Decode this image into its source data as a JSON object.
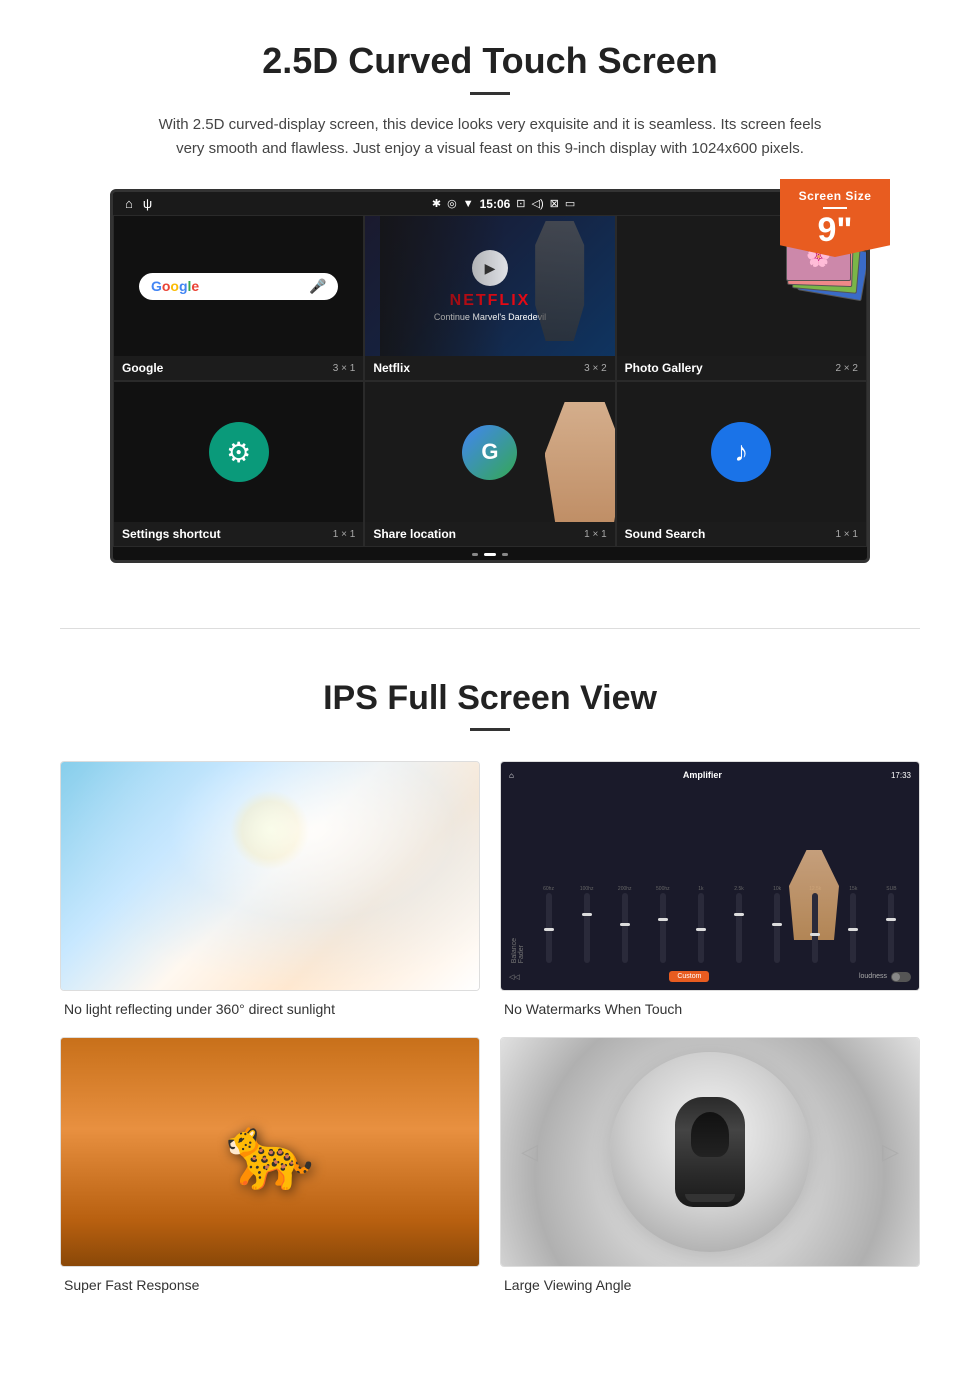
{
  "section1": {
    "title": "2.5D Curved Touch Screen",
    "description": "With 2.5D curved-display screen, this device looks very exquisite and it is seamless. Its screen feels very smooth and flawless. Just enjoy a visual feast on this 9-inch display with 1024x600 pixels.",
    "badge": {
      "label": "Screen Size",
      "size": "9\""
    },
    "statusBar": {
      "time": "15:06",
      "leftIcons": [
        "⌂",
        "ψ"
      ],
      "rightIcons": [
        "✱",
        "◎",
        "▼",
        "☑",
        "⊡",
        "⊟"
      ]
    },
    "apps": [
      {
        "name": "Google",
        "size": "3 × 1",
        "type": "google"
      },
      {
        "name": "Netflix",
        "size": "3 × 2",
        "type": "netflix",
        "subtitle": "Continue Marvel's Daredevil"
      },
      {
        "name": "Photo Gallery",
        "size": "2 × 2",
        "type": "photo-gallery"
      },
      {
        "name": "Settings shortcut",
        "size": "1 × 1",
        "type": "settings"
      },
      {
        "name": "Share location",
        "size": "1 × 1",
        "type": "maps"
      },
      {
        "name": "Sound Search",
        "size": "1 × 1",
        "type": "sound"
      }
    ]
  },
  "section2": {
    "title": "IPS Full Screen View",
    "features": [
      {
        "id": "no-light-reflect",
        "caption": "No light reflecting under 360° direct sunlight",
        "type": "sky"
      },
      {
        "id": "no-watermarks",
        "caption": "No Watermarks When Touch",
        "type": "amplifier"
      },
      {
        "id": "fast-response",
        "caption": "Super Fast Response",
        "type": "cheetah"
      },
      {
        "id": "large-angle",
        "caption": "Large Viewing Angle",
        "type": "car"
      }
    ]
  }
}
